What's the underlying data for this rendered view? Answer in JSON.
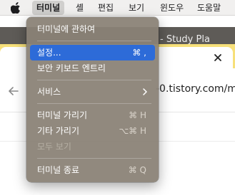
{
  "menubar": {
    "items": [
      "터미널",
      "셸",
      "편집",
      "보기",
      "윈도우",
      "도움말"
    ]
  },
  "browser": {
    "window_title_fragment": "- Study Pla",
    "url_fragment": "-0.tistory.com/m"
  },
  "menu": {
    "about": "터미널에 관하여",
    "settings": {
      "label": "설정...",
      "shortcut": "⌘ ,"
    },
    "secure_keyboard": "보안 키보드 엔트리",
    "services": "서비스",
    "hide_terminal": {
      "label": "터미널 가리기",
      "shortcut": "⌘ H"
    },
    "hide_others": {
      "label": "기타 가리기",
      "shortcut": "⌥⌘ H"
    },
    "show_all": "모두 보기",
    "quit": {
      "label": "터미널 종료",
      "shortcut": "⌘ Q"
    }
  },
  "colors": {
    "highlight": "#2d6bd8",
    "menu_background": "#8a8276",
    "tab_accent": "#f7e07a"
  }
}
